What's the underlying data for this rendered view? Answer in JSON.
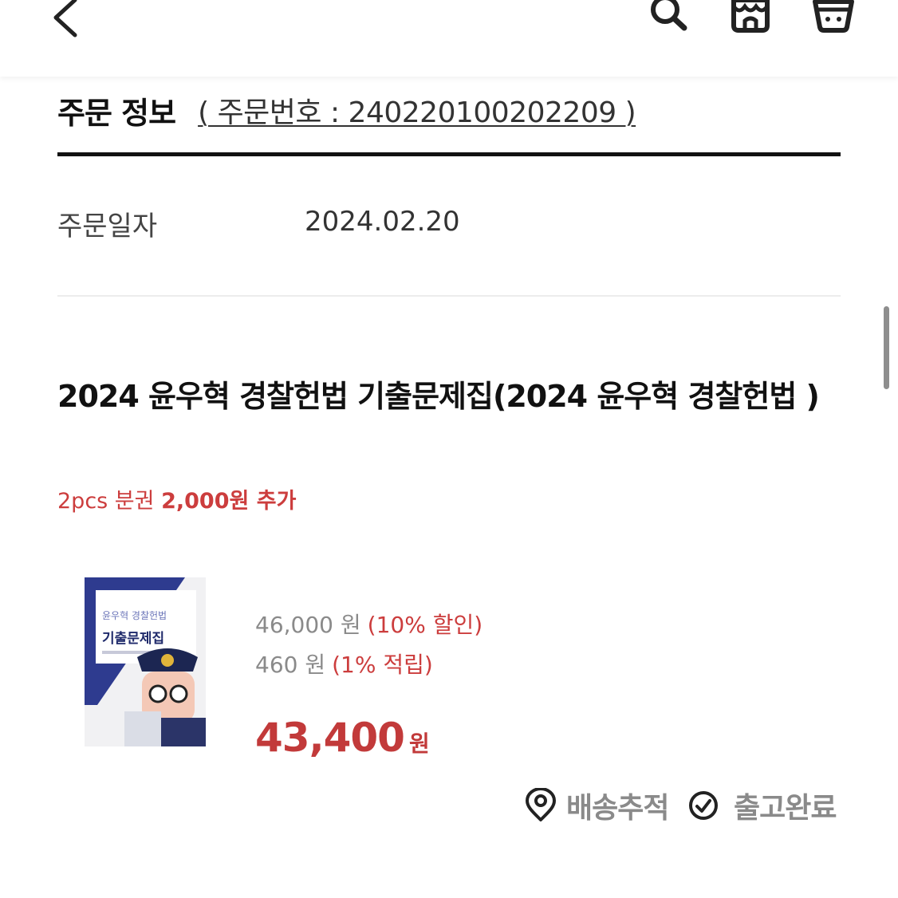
{
  "header": {
    "icons": [
      "back-icon",
      "search-icon",
      "store-icon",
      "cart-icon"
    ]
  },
  "order_info": {
    "title": "주문 정보",
    "order_number": "( 주문번호 : 240220100202209 )"
  },
  "order_date": {
    "label": "주문일자",
    "value": "2024.02.20"
  },
  "product": {
    "name": "2024 윤우혁 경찰헌법 기출문제집(2024 윤우혁 경찰헌법 )",
    "option_text": "2pcs 분권",
    "option_extra": "2,000원 추가",
    "cover_title": "기출문제집",
    "cover_subtitle": "윤우혁 경찰헌법",
    "original_price": "46,000 원",
    "discount_note": "(10% 할인)",
    "points": "460 원",
    "points_note": "(1% 적립)",
    "final_price": "43,400",
    "final_unit": "원"
  },
  "actions": {
    "tracking_label": "배송추적",
    "status_label": "출고완료"
  },
  "colors": {
    "accent": "#cc3d3d",
    "muted": "#8a8a8a",
    "text": "#111111"
  }
}
